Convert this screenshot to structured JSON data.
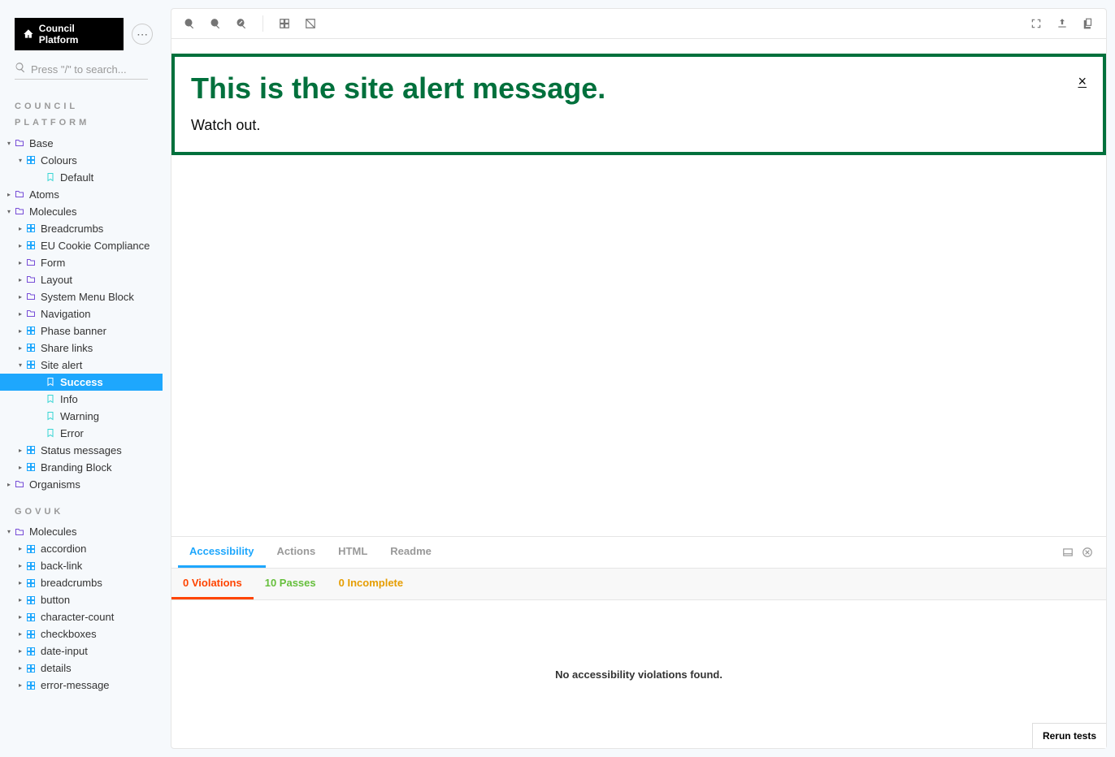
{
  "app": {
    "logo_text": "Council Platform"
  },
  "search": {
    "placeholder": "Press \"/\" to search..."
  },
  "sidebar": {
    "section1_title": "COUNCIL PLATFORM",
    "section2_title": "GOVUK",
    "tree1": [
      {
        "depth": 0,
        "expander": "▾",
        "icon": "folder",
        "label": "Base"
      },
      {
        "depth": 1,
        "expander": "▾",
        "icon": "component",
        "label": "Colours"
      },
      {
        "depth": 2,
        "expander": "",
        "icon": "story",
        "label": "Default"
      },
      {
        "depth": 0,
        "expander": "▸",
        "icon": "folder",
        "label": "Atoms"
      },
      {
        "depth": 0,
        "expander": "▾",
        "icon": "folder",
        "label": "Molecules"
      },
      {
        "depth": 1,
        "expander": "▸",
        "icon": "component",
        "label": "Breadcrumbs"
      },
      {
        "depth": 1,
        "expander": "▸",
        "icon": "component",
        "label": "EU Cookie Compliance"
      },
      {
        "depth": 1,
        "expander": "▸",
        "icon": "folder",
        "label": "Form"
      },
      {
        "depth": 1,
        "expander": "▸",
        "icon": "folder",
        "label": "Layout"
      },
      {
        "depth": 1,
        "expander": "▸",
        "icon": "folder",
        "label": "System Menu Block"
      },
      {
        "depth": 1,
        "expander": "▸",
        "icon": "folder",
        "label": "Navigation"
      },
      {
        "depth": 1,
        "expander": "▸",
        "icon": "component",
        "label": "Phase banner"
      },
      {
        "depth": 1,
        "expander": "▸",
        "icon": "component",
        "label": "Share links"
      },
      {
        "depth": 1,
        "expander": "▾",
        "icon": "component",
        "label": "Site alert"
      },
      {
        "depth": 2,
        "expander": "",
        "icon": "story",
        "label": "Success",
        "selected": true
      },
      {
        "depth": 2,
        "expander": "",
        "icon": "story",
        "label": "Info"
      },
      {
        "depth": 2,
        "expander": "",
        "icon": "story",
        "label": "Warning"
      },
      {
        "depth": 2,
        "expander": "",
        "icon": "story",
        "label": "Error"
      },
      {
        "depth": 1,
        "expander": "▸",
        "icon": "component",
        "label": "Status messages"
      },
      {
        "depth": 1,
        "expander": "▸",
        "icon": "component",
        "label": "Branding Block"
      },
      {
        "depth": 0,
        "expander": "▸",
        "icon": "folder",
        "label": "Organisms"
      }
    ],
    "tree2": [
      {
        "depth": 0,
        "expander": "▾",
        "icon": "folder",
        "label": "Molecules"
      },
      {
        "depth": 1,
        "expander": "▸",
        "icon": "component",
        "label": "accordion"
      },
      {
        "depth": 1,
        "expander": "▸",
        "icon": "component",
        "label": "back-link"
      },
      {
        "depth": 1,
        "expander": "▸",
        "icon": "component",
        "label": "breadcrumbs"
      },
      {
        "depth": 1,
        "expander": "▸",
        "icon": "component",
        "label": "button"
      },
      {
        "depth": 1,
        "expander": "▸",
        "icon": "component",
        "label": "character-count"
      },
      {
        "depth": 1,
        "expander": "▸",
        "icon": "component",
        "label": "checkboxes"
      },
      {
        "depth": 1,
        "expander": "▸",
        "icon": "component",
        "label": "date-input"
      },
      {
        "depth": 1,
        "expander": "▸",
        "icon": "component",
        "label": "details"
      },
      {
        "depth": 1,
        "expander": "▸",
        "icon": "component",
        "label": "error-message"
      }
    ]
  },
  "alert": {
    "title": "This is the site alert message.",
    "body": "Watch out.",
    "close": "×"
  },
  "panel": {
    "tabs": [
      "Accessibility",
      "Actions",
      "HTML",
      "Readme"
    ],
    "subtabs": {
      "violations": "0 Violations",
      "passes": "10 Passes",
      "incomplete": "0 Incomplete"
    },
    "empty_msg": "No accessibility violations found.",
    "rerun": "Rerun tests"
  }
}
